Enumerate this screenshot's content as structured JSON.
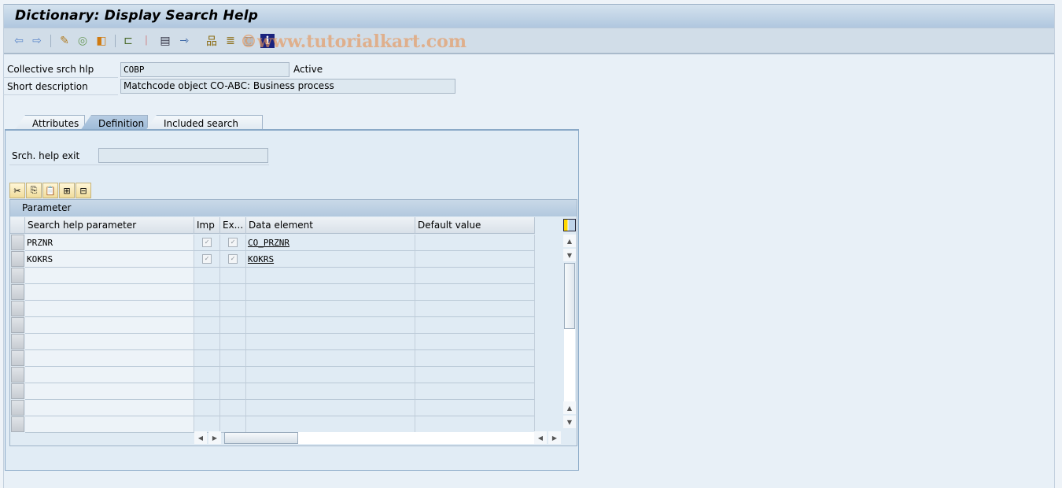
{
  "window": {
    "title": "Dictionary: Display Search Help",
    "watermark": "©www.tutorialkart.com"
  },
  "toolbar": {
    "icons": [
      "back-icon",
      "forward-icon",
      "display-change-icon",
      "active-inactive-icon",
      "other-object-icon",
      "where-used-icon",
      "activate-icon",
      "test-icon",
      "navigate-icon",
      "hierarchy-icon",
      "object-list-icon",
      "display-object-list-icon",
      "info-icon"
    ]
  },
  "header": {
    "collective_label": "Collective srch hlp",
    "collective_value": "COBP",
    "status": "Active",
    "short_desc_label": "Short description",
    "short_desc_value": "Matchcode object CO-ABC: Business process"
  },
  "tabs": [
    {
      "label": "Attributes",
      "active": false
    },
    {
      "label": "Definition",
      "active": true
    },
    {
      "label": "Included search helps",
      "active": false
    }
  ],
  "definition": {
    "exit_label": "Srch. help exit",
    "exit_value": "",
    "grid_toolbar": [
      "cut-icon",
      "copy-icon",
      "paste-icon",
      "insert-row-icon",
      "delete-row-icon"
    ],
    "grid_title": "Parameter",
    "columns": [
      "Search help parameter",
      "Imp",
      "Ex...",
      "Data element",
      "Default value"
    ],
    "rows": [
      {
        "param": "PRZNR",
        "imp": true,
        "exp": true,
        "data_element": "CO_PRZNR",
        "default": ""
      },
      {
        "param": "KOKRS",
        "imp": true,
        "exp": true,
        "data_element": "KOKRS",
        "default": ""
      }
    ],
    "empty_rows": 10
  }
}
